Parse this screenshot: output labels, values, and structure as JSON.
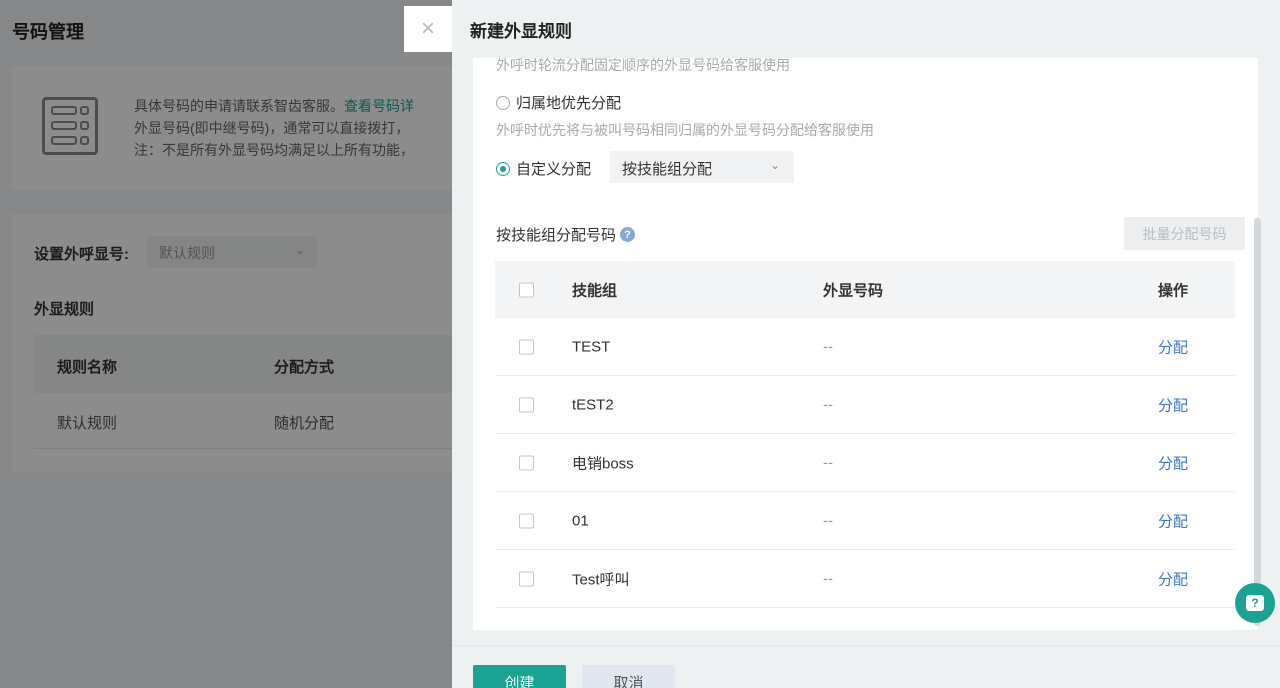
{
  "background": {
    "page_title": "号码管理",
    "info": {
      "line1_text": "具体号码的申请请联系智齿客服。",
      "line1_link": "查看号码详",
      "line2": "外显号码(即中继号码)，通常可以直接拨打，",
      "line3": "注：不是所有外显号码均满足以上所有功能，"
    },
    "set_label": "设置外呼显号:",
    "set_value": "默认规则",
    "section_title": "外显规则",
    "table": {
      "headers": [
        "规则名称",
        "分配方式"
      ],
      "rows": [
        [
          "默认规则",
          "随机分配"
        ]
      ]
    }
  },
  "drawer": {
    "title": "新建外显规则",
    "close_glyph": "×",
    "hint_top": "外呼时轮流分配固定顺序的外显号码给客服使用",
    "option_region": "归属地优先分配",
    "hint_region": "外呼时优先将与被叫号码相同归属的外显号码分配给客服使用",
    "option_custom": "自定义分配",
    "custom_mode": "按技能组分配",
    "section_label": "按技能组分配号码",
    "help_glyph": "?",
    "batch_button": "批量分配号码",
    "table": {
      "headers": {
        "skill": "技能组",
        "number": "外显号码",
        "op": "操作"
      },
      "rows": [
        {
          "skill": "TEST",
          "number": "--",
          "op": "分配"
        },
        {
          "skill": "tEST2",
          "number": "--",
          "op": "分配"
        },
        {
          "skill": "电销boss",
          "number": "--",
          "op": "分配"
        },
        {
          "skill": "01",
          "number": "--",
          "op": "分配"
        },
        {
          "skill": "Test呼叫",
          "number": "--",
          "op": "分配"
        }
      ]
    },
    "create_button": "创建",
    "cancel_button": "取消"
  },
  "colors": {
    "accent": "#1aa393",
    "link": "#3a78c9"
  },
  "icons": {
    "close": "close-icon",
    "help": "help-icon",
    "chat": "chat-help-icon",
    "chevron": "chevron-down-icon",
    "doc": "document-list-icon"
  }
}
